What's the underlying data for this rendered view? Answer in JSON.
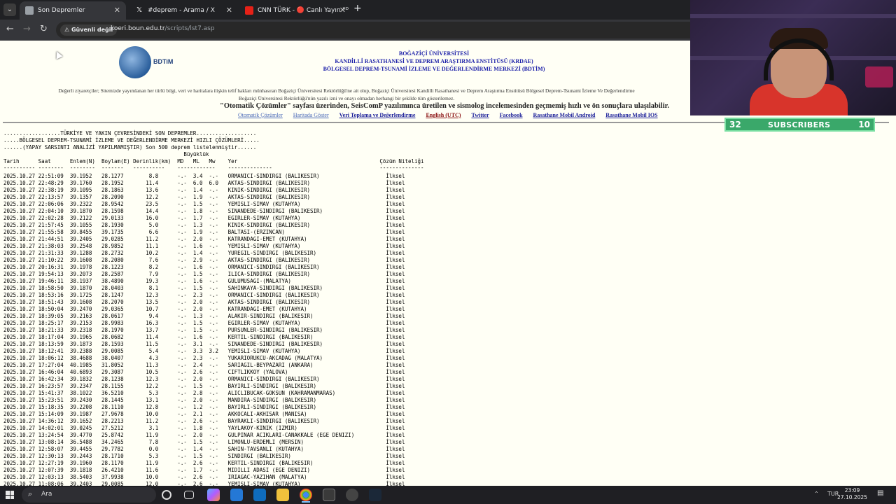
{
  "browser": {
    "tabs": [
      {
        "title": "Son Depremler",
        "active": true
      },
      {
        "title": "#deprem - Arama / X",
        "active": false
      },
      {
        "title": "CNN TÜRK - 🔴 Canlı Yayın ᴴᴰ",
        "active": false
      }
    ],
    "new_tab": "+",
    "security_label": "Güvenli değil",
    "url_host": "koeri.boun.edu.tr",
    "url_path": "/scripts/lst7.asp"
  },
  "page": {
    "logo_text": "BDTiM",
    "header_line1": "BOĞAZİÇİ ÜNİVERSİTESİ",
    "header_line2": "KANDİLLİ RASATHANESİ VE DEPREM ARAŞTIRMA ENSTİTÜSÜ (KRDAE)",
    "header_line3": "BÖLGESEL DEPREM-TSUNAMİ İZLEME VE DEĞERLENDİRME MERKEZİ (BDTİM)",
    "notice_line1": "Değerli ziyaretçiler; Sitemizde yayımlanan her türlü bilgi, veri ve haritalara ilişkin telif hakları münhasıran Boğaziçi Üniversitesi Rektörlüğü'ne ait olup, Boğaziçi Üniversitesi Kandilli Rasathanesi ve Deprem Araştırma Enstitüsü Bölgesel Deprem-Tsunami İzleme Ve Değerlendirme",
    "notice_line2": "Boğaziçi Üniversitesi Rektörlüğü'nün yazılı izni ve onayı olmadan herhangi bir şekilde tüm gösterilemez.",
    "banner": "\"Otomatik Çözümler\" sayfası üzerinden, SeisComP yazılımınca üretilen ve sismolog incelemesinden geçmemiş hızlı ve ön sonuçlara ulaşılabilir.",
    "links": [
      "Otomatik Çözümler",
      "Haritada Göster",
      "Veri Toplama ve Değerlendirme",
      "English (UTC)",
      "Twitter",
      "Facebook",
      "Rasathane Mobil Android",
      "Rasathane Mobil IOS"
    ],
    "pre_title1": "..................TÜRKİYE VE YAKIN ÇEVRESİNDEKİ SON DEPREMLER...................",
    "pre_title2": ".....BÖLGESEL DEPREM-TSUNAMİ İZLEME VE DEĞERLENDİRME MERKEZİ HIZLI ÇÖZÜMLERİ.....",
    "pre_title3": "......(YAPAY SARSINTI ANALİZİ YAPILMAMIŞTIR) Son 500 deprem listelenmiştir......",
    "pre_header_mag": "                                                         Büyüklük",
    "pre_header": "Tarih      Saat      Enlem(N)  Boylam(E) Derinlik(km)  MD   ML   Mw    Yer                                             Çözüm Niteliği",
    "pre_dashes": "---------- --------  --------  -------   ----------    ------------    --------------                                  --------------",
    "rows": [
      "2025.10.27 22:51:09  39.1952   28.1277        8.8      -.-  3.4  -.-   ORMANICI-SINDIRGI (BALIKESIR)                     İlksel",
      "2025.10.27 22:48:29  39.1760   28.1952       11.4      -.-  6.0  6.0   AKTAS-SINDIRGI (BALIKESIR)                        İlksel",
      "2025.10.27 22:38:19  39.1095   28.1863       13.6      -.-  1.4  -.-   KINIK-SINDIRGI (BALIKESIR)                        İlksel",
      "2025.10.27 22:13:57  39.1357   28.2090       12.2      -.-  1.9  -.-   AKTAS-SINDIRGI (BALIKESIR)                        İlksel",
      "2025.10.27 22:06:06  39.2322   28.9542       23.5      -.-  1.5  -.-   YEMISLI-SIMAV (KUTAHYA)                           İlksel",
      "2025.10.27 22:04:10  39.1870   28.1598       14.4      -.-  1.8  -.-   SINANDEDE-SINDIRGI (BALIKESIR)                    İlksel",
      "2025.10.27 22:02:28  39.2122   29.0133       16.0      -.-  1.7  -.-   EGIRLER-SIMAV (KUTAHYA)                           İlksel",
      "2025.10.27 21:57:45  39.1055   28.1930        5.0      -.-  1.3  -.-   KINIK-SINDIRGI (BALIKESIR)                        İlksel",
      "2025.10.27 21:55:58  39.8455   39.1735        6.6      -.-  1.9  -.-   BALTASI-(ERZINCAN)                                İlksel",
      "2025.10.27 21:44:51  39.2405   29.0285       11.2      -.-  2.0  -.-   KATRANDAGI-EMET (KUTAHYA)                         İlksel",
      "2025.10.27 21:38:03  39.2548   28.9852       11.1      -.-  1.6  -.-   YEMISLI-SIMAV (KUTAHYA)                           İlksel",
      "2025.10.27 21:31:33  39.1288   28.2732       10.2      -.-  1.4  -.-   YUREGIL-SINDIRGI (BALIKESIR)                      İlksel",
      "2025.10.27 21:10:22  39.1608   28.2080        7.6      -.-  2.9  -.-   AKTAS-SINDIRGI (BALIKESIR)                        İlksel",
      "2025.10.27 20:16:31  39.1978   28.1223        8.2      -.-  1.6  -.-   ORMANICI-SINDIRGI (BALIKESIR)                     İlksel",
      "2025.10.27 19:54:13  39.2073   28.2587        7.9      -.-  1.5  -.-   ILICA-SINDIRGI (BALIKESIR)                        İlksel",
      "2025.10.27 19:46:11  38.1937   38.4890       19.3      -.-  1.6  -.-   GULUMUSAGI-(MALATYA)                              İlksel",
      "2025.10.27 18:58:50  39.1870   28.0403        8.1      -.-  1.5  -.-   SAHINKAYA-SINDIRGI (BALIKESIR)                    İlksel",
      "2025.10.27 18:53:16  39.1725   28.1247       12.3      -.-  2.3  -.-   ORMANICI-SINDIRGI (BALIKESIR)                     İlksel",
      "2025.10.27 18:51:43  39.1608   28.2070       13.5      -.-  2.0  -.-   AKTAS-SINDIRGI (BALIKESIR)                        İlksel",
      "2025.10.27 18:50:04  39.2470   29.0365       10.7      -.-  2.0  -.-   KATRANDAGI-EMET (KUTAHYA)                         İlksel",
      "2025.10.27 18:39:05  39.2163   28.0617        9.4      -.-  1.3  -.-   ALAKIR-SINDIRGI (BALIKESIR)                       İlksel",
      "2025.10.27 18:25:17  39.2153   28.9983       16.3      -.-  1.5  -.-   EGIRLER-SIMAV (KUTAHYA)                           İlksel",
      "2025.10.27 18:21:33  39.2318   28.1970       13.7      -.-  1.5  -.-   PURSUNLER-SINDIRGI (BALIKESIR)                    İlksel",
      "2025.10.27 18:17:04  39.1965   28.0682       11.4      -.-  1.6  -.-   KERTIL-SINDIRGI (BALIKESIR)                       İlksel",
      "2025.10.27 18:13:59  39.1873   28.1593       11.5      -.-  3.1  -.-   SINANDEDE-SINDIRGI (BALIKESIR)                    İlksel",
      "2025.10.27 18:12:41  39.2388   29.0085        5.4      -.-  3.3  3.2   YEMISLI-SIMAV (KUTAHYA)                           İlksel",
      "2025.10.27 18:06:12  38.4688   38.0407        4.3      -.-  2.3  -.-   YUKARIORUKCU-AKCADAG (MALATYA)                    İlksel",
      "2025.10.27 17:27:04  40.1985   31.8052       11.3      -.-  2.4  -.-   SARIAGIL-BEYPAZARI (ANKARA)                       İlksel",
      "2025.10.27 16:46:04  40.6893   29.3087       10.5      -.-  2.6  -.-   CIFTLIKKOY (YALOVA)                               İlksel",
      "2025.10.27 16:42:34  39.1832   28.1238       12.3      -.-  2.0  -.-   ORMANICI-SINDIRGI (BALIKESIR)                     İlksel",
      "2025.10.27 16:23:57  39.2347   28.1155       12.2      -.-  1.5  -.-   BAYIRLI-SINDIRGI (BALIKESIR)                      İlksel",
      "2025.10.27 15:41:37  38.1022   36.5210        5.3      -.-  2.8  -.-   ALICLIBUCAK-GOKSUN (KAHRAMANMARAS)                İlksel",
      "2025.10.27 15:23:51  39.2430   28.1445       13.1      -.-  2.0  -.-   MANDIRA-SINDIRGI (BALIKESIR)                      İlksel",
      "2025.10.27 15:18:35  39.2208   28.1110       12.8      -.-  1.2  -.-   BAYIRLI-SINDIRGI (BALIKESIR)                      İlksel",
      "2025.10.27 15:14:09  39.1987   27.9678       10.0      -.-  2.1  -.-   AKKOCALI-AKHISAR (MANISA)                         İlksel",
      "2025.10.27 14:36:12  39.1652   28.2213       11.2      -.-  2.6  -.-   BAYRAKLI-SINDIRGI (BALIKESIR)                     İlksel",
      "2025.10.27 14:02:01  39.0245   27.5212        3.1      -.-  1.8  -.-   YAYLAKOY-KINIK (IZMIR)                            İlksel",
      "2025.10.27 13:24:54  39.4770   25.8742       11.9      -.-  2.0  -.-   GULPINAR ACIKLARI-CANAKKALE (EGE DENIZI)          İlksel",
      "2025.10.27 13:08:14  36.5488   34.2465        7.8      -.-  1.5  -.-   LIMONLU-ERDEMLI (MERSIN)                          İlksel",
      "2025.10.27 12:58:07  39.4455   29.7782        0.0      -.-  1.4  -.-   SAHIN-TAVSANLI (KUTAHYA)                          İlksel",
      "2025.10.27 12:30:13  39.2443   28.1710        5.3      -.-  1.5  -.-   SINDIRGI (BALIKESIR)                              İlksel",
      "2025.10.27 12:27:19  39.1960   28.1170       11.9      -.-  2.6  -.-   KERTIL-SINDIRGI (BALIKESIR)                       İlksel",
      "2025.10.27 12:07:39  39.1818   26.4210       11.6      -.-  1.7  -.-   MIDILLI ADASI (EGE DENIZI)                        İlksel",
      "2025.10.27 12:03:13  38.5403   37.9938       10.0      -.-  2.6  -.-   IRIAGAC-YAZIHAN (MALATYA)                         İlksel",
      "2025.10.27 11:08:06  39.2403   29.0085       12.0      -.-  2.6  -.-   YEMISLI-SIMAV (KUTAHYA)                           İlksel"
    ]
  },
  "overlay": {
    "subs_left": "32",
    "subs_label": "SUBSCRIBERS",
    "subs_right": "10"
  },
  "taskbar": {
    "search_placeholder": "Ara",
    "lang": "TUR",
    "time": "23:09",
    "date": "27.10.2025"
  }
}
